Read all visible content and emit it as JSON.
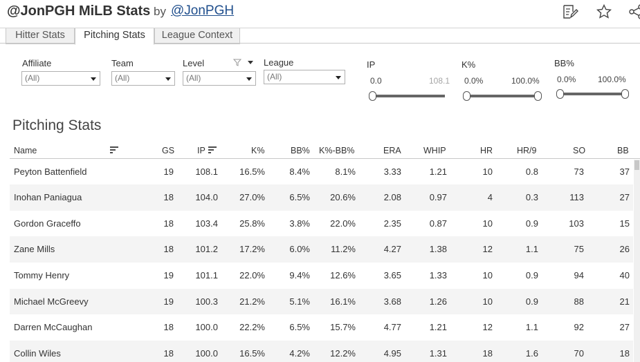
{
  "header": {
    "title": "@JonPGH MiLB Stats",
    "by": "by",
    "author": "@JonPGH",
    "icons": [
      "edit-icon",
      "star-icon",
      "share-icon"
    ]
  },
  "tabs": [
    {
      "label": "Hitter Stats",
      "active": false
    },
    {
      "label": "Pitching Stats",
      "active": true
    },
    {
      "label": "League Context",
      "active": false
    }
  ],
  "filters": {
    "affiliate": {
      "label": "Affiliate",
      "value": "(All)"
    },
    "team": {
      "label": "Team",
      "value": "(All)"
    },
    "level": {
      "label": "Level",
      "value": "(All)"
    },
    "league": {
      "label": "League",
      "value": "(All)"
    }
  },
  "ranges": {
    "ip": {
      "label": "IP",
      "min": "0.0",
      "max": "108.1"
    },
    "k_pct": {
      "label": "K%",
      "min": "0.0%",
      "max": "100.0%"
    },
    "bb_pct": {
      "label": "BB%",
      "min": "0.0%",
      "max": "100.0%"
    }
  },
  "section_title": "Pitching Stats",
  "columns": [
    "Name",
    "GS",
    "IP",
    "K%",
    "BB%",
    "K%-BB%",
    "ERA",
    "WHIP",
    "HR",
    "HR/9",
    "SO",
    "BB"
  ],
  "rows": [
    [
      "Peyton Battenfield",
      "19",
      "108.1",
      "16.5%",
      "8.4%",
      "8.1%",
      "3.33",
      "1.21",
      "10",
      "0.8",
      "73",
      "37"
    ],
    [
      "Inohan Paniagua",
      "18",
      "104.0",
      "27.0%",
      "6.5%",
      "20.6%",
      "2.08",
      "0.97",
      "4",
      "0.3",
      "113",
      "27"
    ],
    [
      "Gordon Graceffo",
      "18",
      "103.4",
      "25.8%",
      "3.8%",
      "22.0%",
      "2.35",
      "0.87",
      "10",
      "0.9",
      "103",
      "15"
    ],
    [
      "Zane Mills",
      "18",
      "101.2",
      "17.2%",
      "6.0%",
      "11.2%",
      "4.27",
      "1.38",
      "12",
      "1.1",
      "75",
      "26"
    ],
    [
      "Tommy Henry",
      "19",
      "101.1",
      "22.0%",
      "9.4%",
      "12.6%",
      "3.65",
      "1.33",
      "10",
      "0.9",
      "94",
      "40"
    ],
    [
      "Michael McGreevy",
      "19",
      "100.3",
      "21.2%",
      "5.1%",
      "16.1%",
      "3.68",
      "1.26",
      "10",
      "0.9",
      "88",
      "21"
    ],
    [
      "Darren McCaughan",
      "18",
      "100.0",
      "22.2%",
      "6.5%",
      "15.7%",
      "4.77",
      "1.21",
      "12",
      "1.1",
      "92",
      "27"
    ],
    [
      "Collin Wiles",
      "18",
      "100.0",
      "16.5%",
      "4.2%",
      "12.2%",
      "4.95",
      "1.31",
      "18",
      "1.6",
      "70",
      "18"
    ]
  ],
  "colors": {
    "link": "#1f4e8c",
    "row_alt": "#f4f4f4",
    "text": "#333333"
  }
}
